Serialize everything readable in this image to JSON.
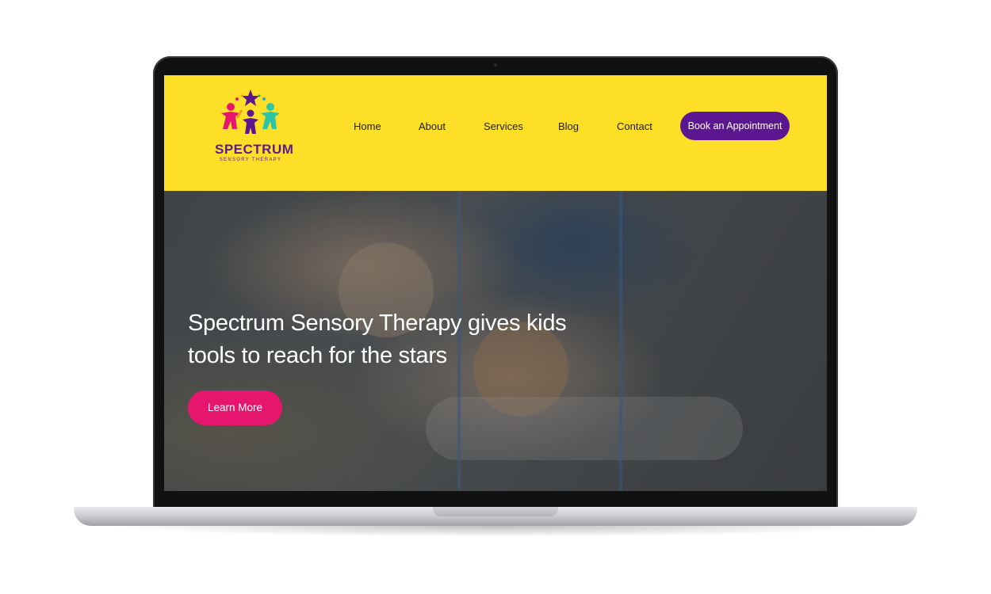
{
  "brand": {
    "name": "SPECTRUM",
    "tagline": "SENSORY THERAPY",
    "colors": {
      "header_bg": "#fedf28",
      "purple": "#5b1690",
      "pink": "#e6166e"
    }
  },
  "nav": {
    "items": [
      {
        "label": "Home"
      },
      {
        "label": "About"
      },
      {
        "label": "Services"
      },
      {
        "label": "Blog"
      },
      {
        "label": "Contact"
      }
    ],
    "cta_label": "Book an Appointment"
  },
  "hero": {
    "headline": "Spectrum Sensory Therapy gives kids tools to reach for the stars",
    "button_label": "Learn More"
  }
}
